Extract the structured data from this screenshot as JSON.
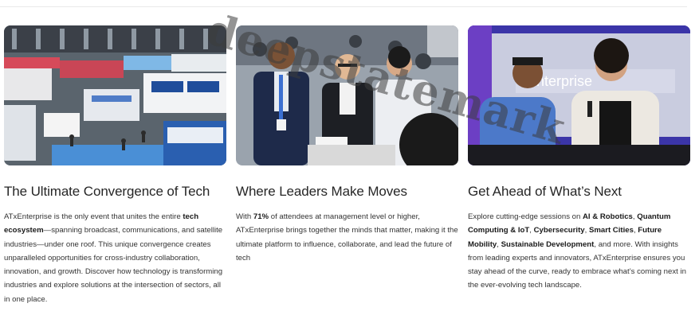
{
  "watermark": "deepstatemark",
  "cards": [
    {
      "image_desc": "exhibition-hall-photo",
      "title": "The Ultimate Convergence of Tech",
      "body": [
        {
          "t": "ATxEnterprise is the only event that unites the entire ",
          "b": false
        },
        {
          "t": "tech ecosystem",
          "b": true
        },
        {
          "t": "—spanning broadcast, communications, and satellite industries—under one roof. This unique convergence creates unparalleled opportunities for cross-industry collaboration, innovation, and growth. Discover how technology is transforming industries and explore solutions at the intersection of sectors, all in one place.",
          "b": false
        }
      ]
    },
    {
      "image_desc": "networking-crowd-photo",
      "title": "Where Leaders Make Moves",
      "body": [
        {
          "t": "With ",
          "b": false
        },
        {
          "t": "71%",
          "b": true
        },
        {
          "t": " of attendees at management level or higher, ATxEnterprise brings together the minds that matter, making it the ultimate platform to influence, collaborate, and lead the future of tech",
          "b": false
        }
      ]
    },
    {
      "image_desc": "panel-speakers-photo",
      "screen_text": "xEnterprise",
      "title": "Get Ahead of What’s Next",
      "body": [
        {
          "t": "Explore cutting-edge sessions on ",
          "b": false
        },
        {
          "t": "AI & Robotics",
          "b": true
        },
        {
          "t": ", ",
          "b": false
        },
        {
          "t": "Quantum Computing & IoT",
          "b": true
        },
        {
          "t": ", ",
          "b": false
        },
        {
          "t": "Cybersecurity",
          "b": true
        },
        {
          "t": ", ",
          "b": false
        },
        {
          "t": "Smart Cities",
          "b": true
        },
        {
          "t": ", ",
          "b": false
        },
        {
          "t": "Future Mobility",
          "b": true
        },
        {
          "t": ", ",
          "b": false
        },
        {
          "t": "Sustainable Development",
          "b": true
        },
        {
          "t": ", and more. With insights from leading experts and innovators, ATxEnterprise ensures you stay ahead of the curve, ready to embrace what’s coming next in the ever-evolving tech landscape.",
          "b": false
        }
      ]
    }
  ]
}
